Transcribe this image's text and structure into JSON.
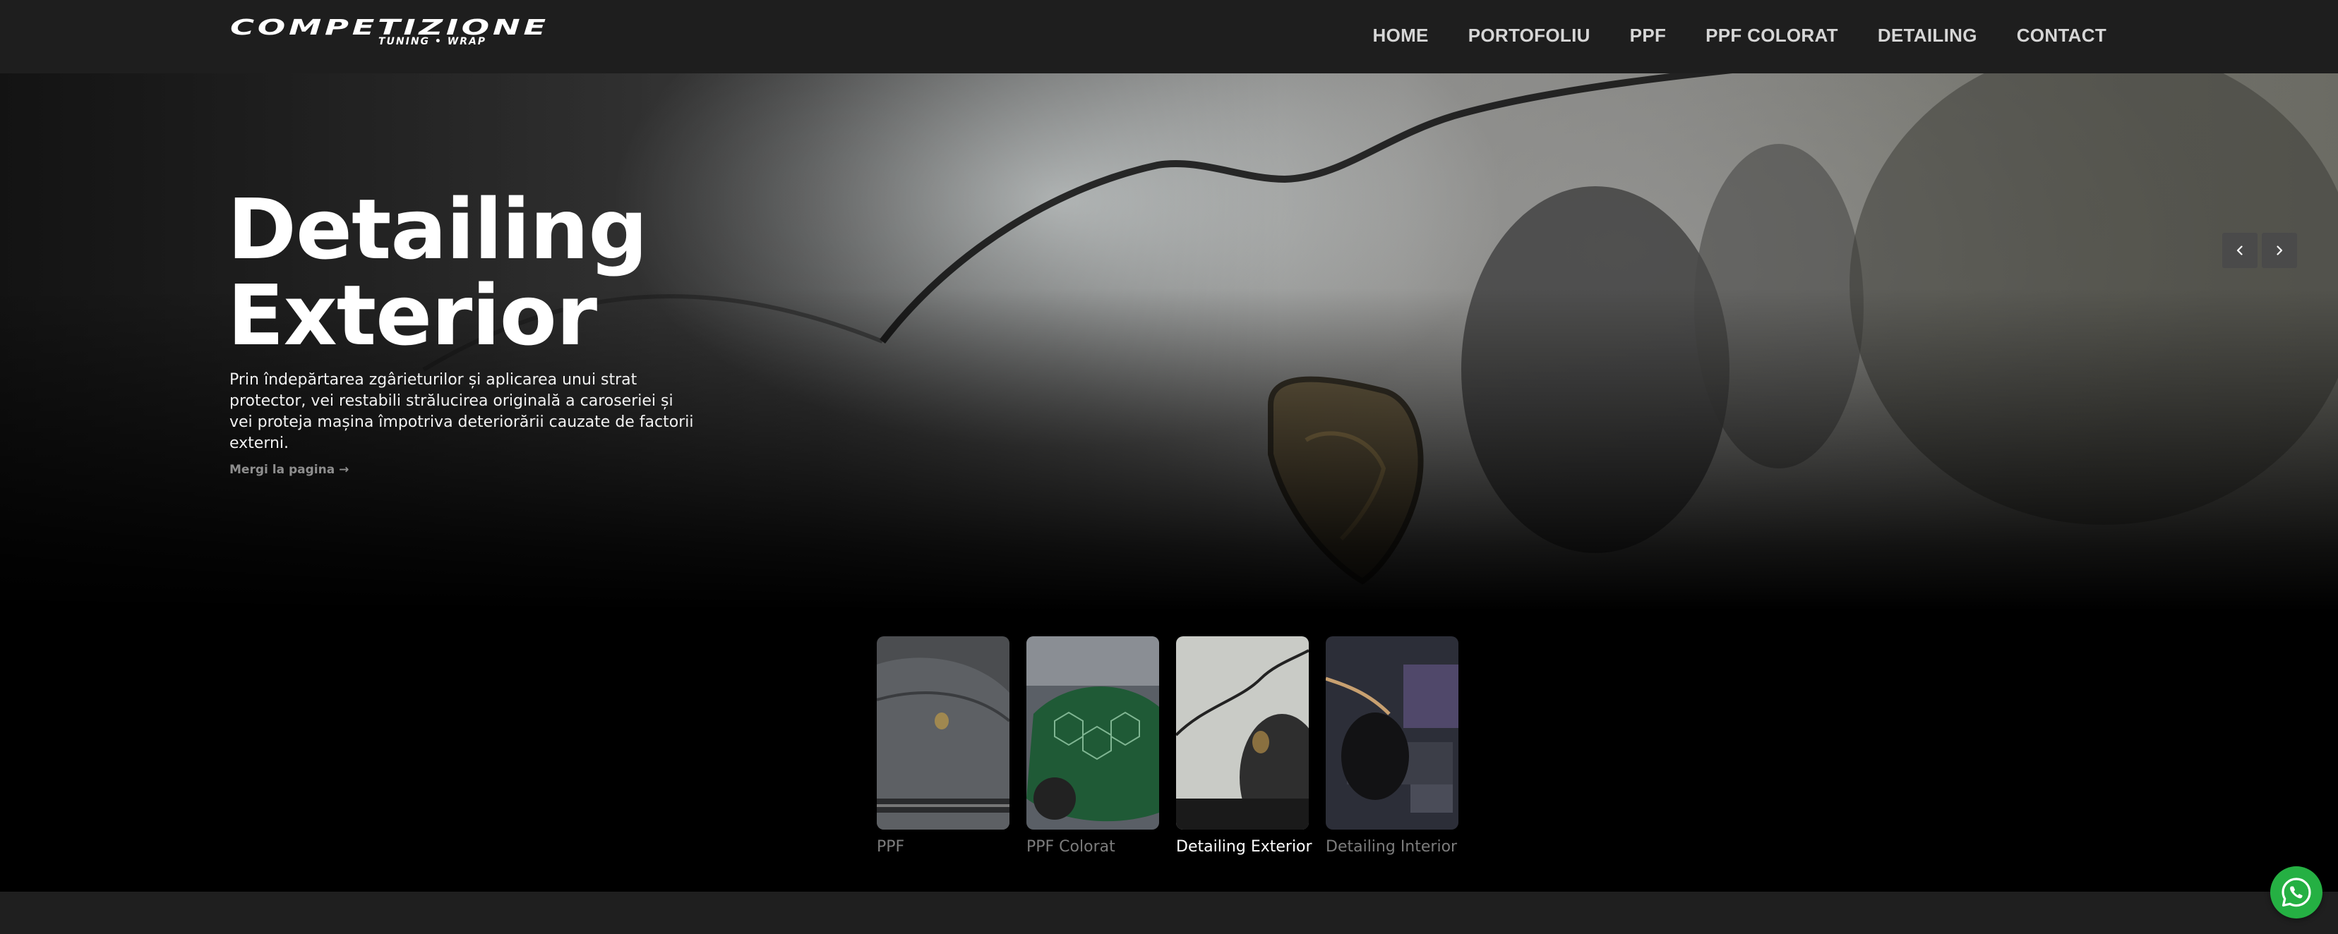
{
  "brand": {
    "logo_main": "COMPETIZIONE",
    "logo_sub": "TUNING • WRAP"
  },
  "nav": {
    "items": [
      "HOME",
      "PORTOFOLIU",
      "PPF",
      "PPF COLORAT",
      "DETAILING",
      "CONTACT"
    ]
  },
  "hero": {
    "title_line1": "Detailing",
    "title_line2": "Exterior",
    "description": "Prin îndepărtarea zgârieturilor și aplicarea unui strat protector, vei restabili strălucirea originală a caroseriei și vei proteja mașina împotriva deteriorării cauzate de factorii externi.",
    "link_label": "Mergi la pagina →"
  },
  "slider": {
    "prev_icon": "chevron-left-icon",
    "next_icon": "chevron-right-icon"
  },
  "thumbnails": [
    {
      "label": "PPF",
      "active": false
    },
    {
      "label": "PPF Colorat",
      "active": false
    },
    {
      "label": "Detailing Exterior",
      "active": true
    },
    {
      "label": "Detailing Interior",
      "active": false
    }
  ],
  "colors": {
    "header_bg": "#1e1e1e",
    "whatsapp_green": "#25b043",
    "inactive_label": "#7c7c7c"
  },
  "widgets": {
    "whatsapp_icon": "whatsapp-icon"
  }
}
